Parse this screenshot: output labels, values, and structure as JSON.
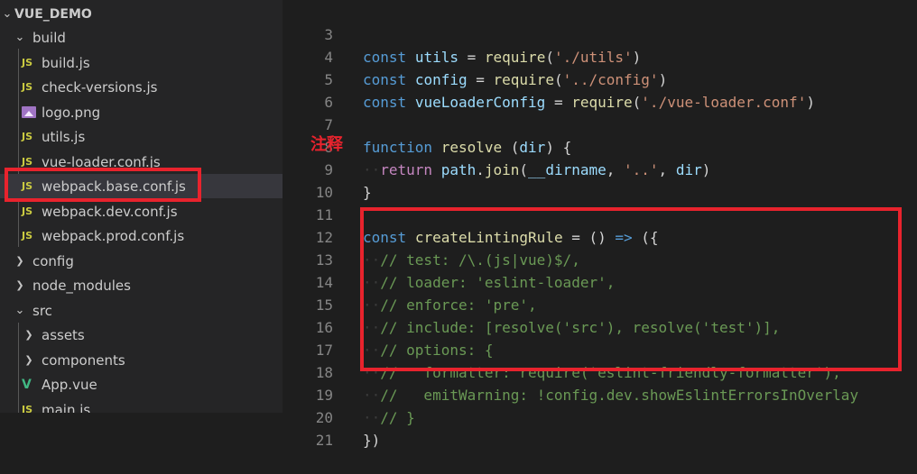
{
  "explorer": {
    "root": "VUE_DEMO",
    "items": [
      {
        "label": "build",
        "type": "folder-open"
      },
      {
        "label": "build.js",
        "type": "js"
      },
      {
        "label": "check-versions.js",
        "type": "js"
      },
      {
        "label": "logo.png",
        "type": "image"
      },
      {
        "label": "utils.js",
        "type": "js"
      },
      {
        "label": "vue-loader.conf.js",
        "type": "js"
      },
      {
        "label": "webpack.base.conf.js",
        "type": "js"
      },
      {
        "label": "webpack.dev.conf.js",
        "type": "js"
      },
      {
        "label": "webpack.prod.conf.js",
        "type": "js"
      },
      {
        "label": "config",
        "type": "folder-closed"
      },
      {
        "label": "node_modules",
        "type": "folder-closed"
      },
      {
        "label": "src",
        "type": "folder-open"
      },
      {
        "label": "assets",
        "type": "folder-closed"
      },
      {
        "label": "components",
        "type": "folder-closed"
      },
      {
        "label": "App.vue",
        "type": "vue"
      },
      {
        "label": "main.js",
        "type": "js"
      }
    ],
    "js_badge": "JS",
    "vue_badge": "V"
  },
  "annotation": {
    "text": "注释",
    "color": "#e8232d"
  },
  "editor": {
    "line_numbers": [
      "3",
      "4",
      "5",
      "6",
      "7",
      "8",
      "9",
      "10",
      "11",
      "12",
      "13",
      "14",
      "15",
      "16",
      "17",
      "18",
      "19",
      "20",
      "21"
    ],
    "lines": {
      "l3": {
        "kw": "const",
        "name": "utils",
        "eq": " = ",
        "fn": "require",
        "open": "(",
        "str": "'./utils'",
        "close": ")"
      },
      "l4": {
        "kw": "const",
        "name": "config",
        "eq": " = ",
        "fn": "require",
        "open": "(",
        "str": "'../config'",
        "close": ")"
      },
      "l5": {
        "kw": "const",
        "name": "vueLoaderConfig",
        "eq": " = ",
        "fn": "require",
        "open": "(",
        "str": "'./vue-loader.conf'",
        "close": ")"
      },
      "l7": {
        "kw": "function",
        "fn": "resolve",
        "rest": " (",
        "param": "dir",
        "end": ") {"
      },
      "l8": {
        "ctl": "return",
        "obj": "path",
        "dot": ".",
        "fn": "join",
        "open": "(",
        "arg1": "__dirname",
        "sep": ", ",
        "str": "'..'",
        "sep2": ", ",
        "arg2": "dir",
        "close": ")"
      },
      "l9": {
        "text": "}"
      },
      "l11": {
        "kw": "const",
        "fn": "createLintingRule",
        "rest": " = () ",
        "arrow": "=>",
        "end": " ({"
      },
      "l12": "// test: /\\.(js|vue)$/,",
      "l13": "// loader: 'eslint-loader',",
      "l14": "// enforce: 'pre',",
      "l15": "// include: [resolve('src'), resolve('test')],",
      "l16": "// options: {",
      "l17": "//   formatter: require('eslint-friendly-formatter'),",
      "l18": "//   emitWarning: !config.dev.showEslintErrorsInOverlay",
      "l19": "// }",
      "l20": "})"
    }
  }
}
